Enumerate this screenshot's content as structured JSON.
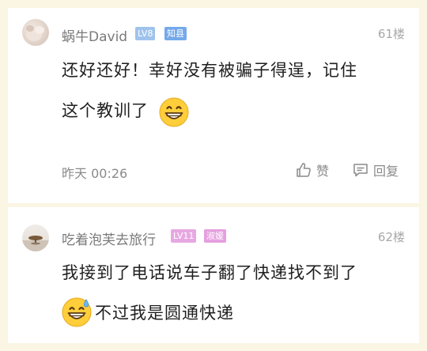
{
  "comments": [
    {
      "username": "蜗牛David",
      "level": "LV8",
      "title": "知县",
      "floor": "61楼",
      "lines": [
        "还好还好！幸好没有被骗子得逞，记住",
        "这个教训了"
      ],
      "emoji": "grinning-face-icon",
      "time": "昨天 00:26",
      "like_label": "赞",
      "reply_label": "回复",
      "badge_colors": {
        "level": "#9fc3ec",
        "title": "#74a9ea"
      }
    },
    {
      "username": "吃着泡芙去旅行",
      "level": "LV11",
      "title": "淑媛",
      "floor": "62楼",
      "lines": [
        "我接到了电话说车子翻了快递找不到了",
        "不过我是圆通快递"
      ],
      "emoji": "grinning-face-with-sweat-icon",
      "badge_colors": {
        "level": "#e7a8e1",
        "title": "#e59fde"
      }
    }
  ],
  "colors": {
    "page_background": "#fbf6e4",
    "card_background": "#ffffff",
    "username": "#7a7a7a",
    "body_text": "#1f1f1f",
    "meta_text": "#8a8a8a"
  }
}
